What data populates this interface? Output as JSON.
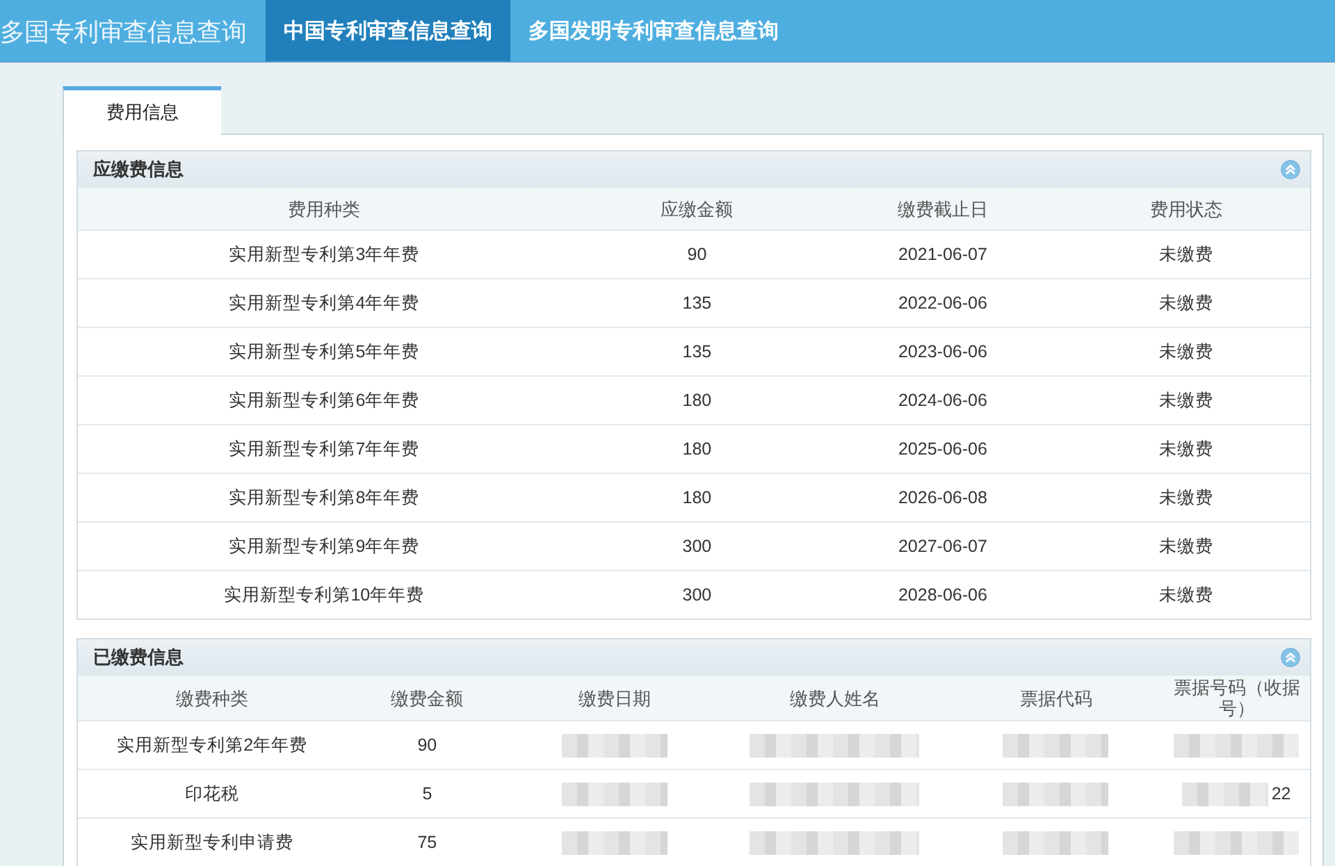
{
  "header": {
    "title": "多国专利审查信息查询",
    "tabs": [
      {
        "label": "中国专利审查信息查询",
        "selected": true
      },
      {
        "label": "多国发明专利审查信息查询",
        "selected": false
      }
    ]
  },
  "page_tabs": [
    {
      "label": "费用信息",
      "selected": true
    }
  ],
  "sections": [
    {
      "title": "应缴费信息",
      "expanded": true,
      "columns": [
        "费用种类",
        "应缴金额",
        "缴费截止日",
        "费用状态"
      ],
      "rows": [
        [
          "实用新型专利第3年年费",
          "90",
          "2021-06-07",
          "未缴费"
        ],
        [
          "实用新型专利第4年年费",
          "135",
          "2022-06-06",
          "未缴费"
        ],
        [
          "实用新型专利第5年年费",
          "135",
          "2023-06-06",
          "未缴费"
        ],
        [
          "实用新型专利第6年年费",
          "180",
          "2024-06-06",
          "未缴费"
        ],
        [
          "实用新型专利第7年年费",
          "180",
          "2025-06-06",
          "未缴费"
        ],
        [
          "实用新型专利第8年年费",
          "180",
          "2026-06-08",
          "未缴费"
        ],
        [
          "实用新型专利第9年年费",
          "300",
          "2027-06-07",
          "未缴费"
        ],
        [
          "实用新型专利第10年年费",
          "300",
          "2028-06-06",
          "未缴费"
        ]
      ]
    },
    {
      "title": "已缴费信息",
      "expanded": true,
      "columns": [
        "缴费种类",
        "缴费金额",
        "缴费日期",
        "缴费人姓名",
        "票据代码",
        "票据号码（收据号）"
      ],
      "rows": [
        [
          "实用新型专利第2年年费",
          "90",
          {
            "kind": "redacted"
          },
          {
            "kind": "redacted"
          },
          {
            "kind": "redacted"
          },
          {
            "kind": "redacted"
          }
        ],
        [
          "印花税",
          "5",
          {
            "kind": "redacted"
          },
          {
            "kind": "redacted"
          },
          {
            "kind": "redacted"
          },
          {
            "kind": "redacted",
            "text": "22"
          }
        ],
        [
          "实用新型专利申请费",
          "75",
          {
            "kind": "redacted"
          },
          {
            "kind": "redacted"
          },
          {
            "kind": "redacted"
          },
          {
            "kind": "redacted"
          }
        ]
      ]
    }
  ]
}
